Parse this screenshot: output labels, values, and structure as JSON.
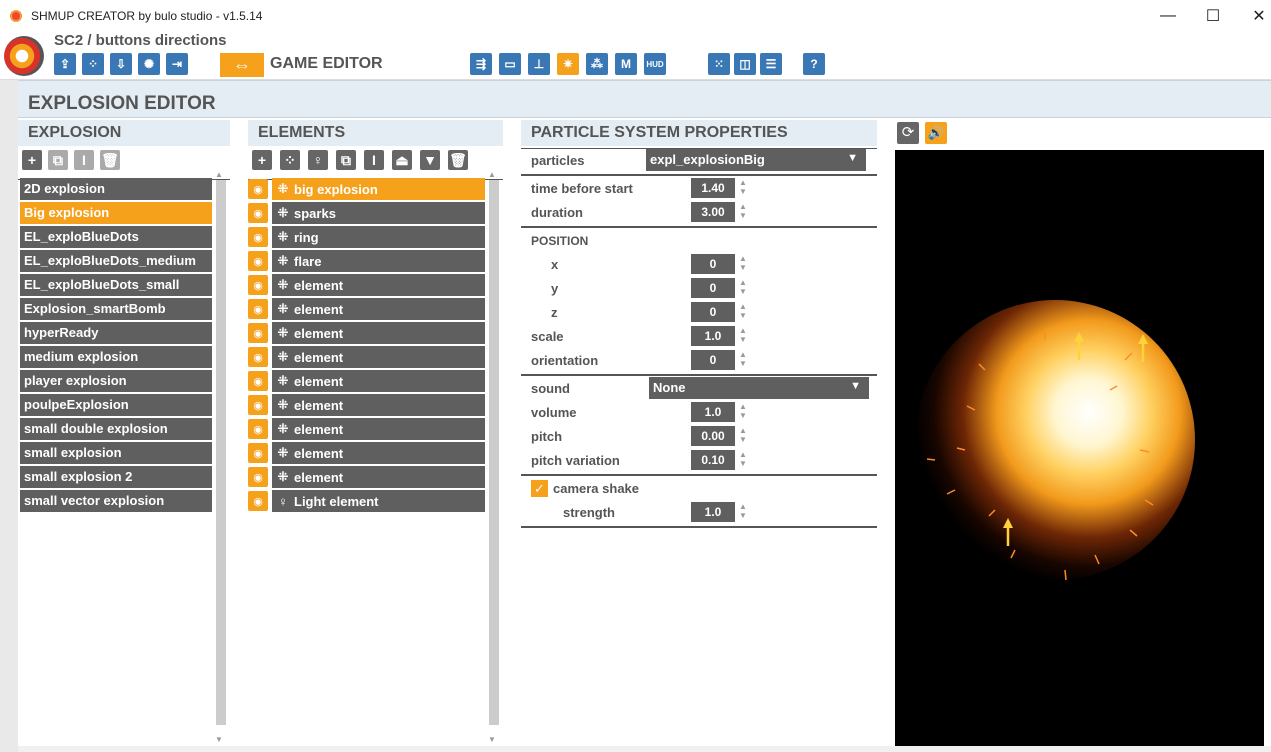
{
  "window": {
    "title": "SHMUP CREATOR by bulo studio - v1.5.14",
    "minimize": "—",
    "maximize": "☐",
    "close": "✕"
  },
  "app": {
    "project": "SC2 / buttons directions",
    "mode_label": "GAME EDITOR",
    "toolbar_left": [
      "upload-icon",
      "grid-icon",
      "download-icon",
      "settings-icon",
      "exit-icon"
    ],
    "toolbar_right": [
      "paths-icon",
      "screen-icon",
      "ship-icon",
      "explosion-icon",
      "particles-icon",
      "m-icon",
      "hud-icon",
      "grid-icon",
      "gamepad-icon",
      "layers-icon",
      "help-icon"
    ]
  },
  "editor": {
    "title": "EXPLOSION EDITOR"
  },
  "explosions": {
    "header": "EXPLOSION",
    "items": [
      "2D explosion",
      "Big explosion",
      "EL_exploBlueDots",
      "EL_exploBlueDots_medium",
      "EL_exploBlueDots_small",
      "Explosion_smartBomb",
      "hyperReady",
      "medium explosion",
      "player explosion",
      "poulpeExplosion",
      "small double explosion",
      "small explosion",
      "small explosion 2",
      "small vector explosion"
    ],
    "selected": 1
  },
  "elements": {
    "header": "ELEMENTS",
    "items": [
      "big explosion",
      "sparks",
      "ring",
      "flare",
      "element",
      "element",
      "element",
      "element",
      "element",
      "element",
      "element",
      "element",
      "element",
      "Light element"
    ],
    "selected": 0
  },
  "properties": {
    "header": "PARTICLE SYSTEM PROPERTIES",
    "particles_label": "particles",
    "particles_value": "expl_explosionBig",
    "time_before_start_label": "time before start",
    "time_before_start": "1.40",
    "duration_label": "duration",
    "duration": "3.00",
    "position_label": "POSITION",
    "x_label": "x",
    "x": "0",
    "y_label": "y",
    "y": "0",
    "z_label": "z",
    "z": "0",
    "scale_label": "scale",
    "scale": "1.0",
    "orientation_label": "orientation",
    "orientation": "0",
    "sound_label": "sound",
    "sound_value": "None",
    "volume_label": "volume",
    "volume": "1.0",
    "pitch_label": "pitch",
    "pitch": "0.00",
    "pitch_variation_label": "pitch variation",
    "pitch_variation": "0.10",
    "camera_shake_label": "camera shake",
    "camera_shake": true,
    "strength_label": "strength",
    "strength": "1.0"
  },
  "colors": {
    "accent": "#f5a11c",
    "item_bg": "#5f5f5f",
    "header_bg": "#e4ecf4",
    "toolbar_blue": "#3a78b5"
  }
}
